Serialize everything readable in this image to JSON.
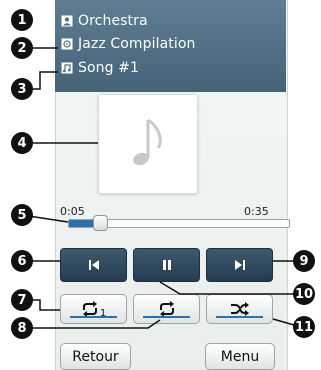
{
  "header": {
    "artist": "Orchestra",
    "album": "Jazz Compilation",
    "track": "Song #1"
  },
  "artwork": {
    "icon": "music-note-icon"
  },
  "playback": {
    "elapsed": "0:05",
    "total": "0:35",
    "progress_fraction": 0.143
  },
  "transport": {
    "previous_icon": "skip-previous-icon",
    "pause_icon": "pause-icon",
    "next_icon": "skip-next-icon"
  },
  "modes": {
    "repeat_one_icon": "repeat-one-icon",
    "repeat_one_sub": "1",
    "repeat_all_icon": "repeat-all-icon",
    "shuffle_icon": "shuffle-icon"
  },
  "footer": {
    "back_label": "Retour",
    "menu_label": "Menu"
  },
  "callouts": [
    "1",
    "2",
    "3",
    "4",
    "5",
    "6",
    "7",
    "8",
    "9",
    "10",
    "11"
  ],
  "colors": {
    "header_bg": "#4f6e83",
    "transport_bg": "#2f4a5e",
    "accent": "#2a6fb0"
  }
}
